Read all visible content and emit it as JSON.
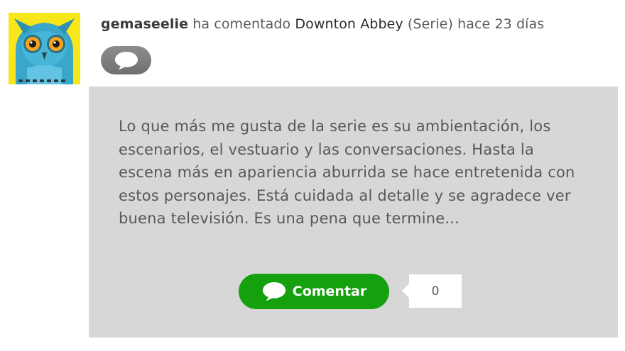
{
  "activity": {
    "username": "gemaseelie",
    "action": "ha comentado",
    "show_title": "Downton Abbey",
    "show_type": "(Serie)",
    "time_ago": "hace 23 días"
  },
  "comment": {
    "text": "Lo que más me gusta de la serie es su ambientación, los escenarios, el vestuario y las conversaciones. Hasta la escena más en apariencia aburrida se hace entretenida con estos personajes. Está cuidada al detalle y se agradece ver buena televisión. Es una pena que termine..."
  },
  "actions": {
    "comment_button_label": "Comentar",
    "comment_count": "0"
  },
  "icons": {
    "avatar": "owl-avatar",
    "comment_type": "speech-bubble-icon",
    "comment_button": "speech-bubble-icon"
  },
  "colors": {
    "avatar_background": "#f7e71a",
    "comment_box_background": "#d7d7d7",
    "comment_button_green": "#14a10d",
    "comment_type_pill_gray": "#7d7d7d"
  }
}
